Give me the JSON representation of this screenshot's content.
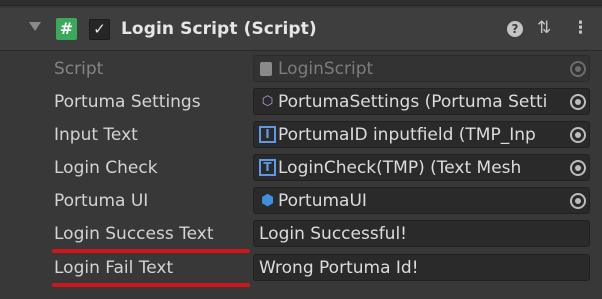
{
  "component": {
    "title": "Login Script (Script)",
    "enabled": true,
    "script_icon_glyph": "#",
    "checkbox_glyph": "✓",
    "help_glyph": "?",
    "presets_glyph": "⇅",
    "menu_glyph": "⋮"
  },
  "properties": [
    {
      "label": "Script",
      "value": "LoginScript",
      "icon": "script-file-icon",
      "disabled": true,
      "type": "object"
    },
    {
      "label": "Portuma Settings",
      "value": "PortumaSettings (Portuma Setti",
      "icon": "scriptable-object-icon",
      "disabled": false,
      "type": "object"
    },
    {
      "label": "Input Text",
      "value": "PortumaID inputfield (TMP_Inp",
      "icon": "textmeshpro-input-icon",
      "disabled": false,
      "type": "object"
    },
    {
      "label": "Login Check",
      "value": "LoginCheck(TMP) (Text Mesh",
      "icon": "textmeshpro-text-icon",
      "disabled": false,
      "type": "object"
    },
    {
      "label": "Portuma UI",
      "value": "PortumaUI",
      "icon": "gameobject-cube-icon",
      "disabled": false,
      "type": "object"
    },
    {
      "label": "Login Success Text",
      "value": "Login Successful!",
      "disabled": false,
      "type": "text"
    },
    {
      "label": "Login Fail Text",
      "value": "Wrong Portuma Id!",
      "disabled": false,
      "type": "text"
    }
  ],
  "icon_glyphs": {
    "script": "▤",
    "settings": "⬡",
    "tmp": "I",
    "tmp_text": "T",
    "cube": "⬢"
  },
  "annotation_color": "#d0161b"
}
